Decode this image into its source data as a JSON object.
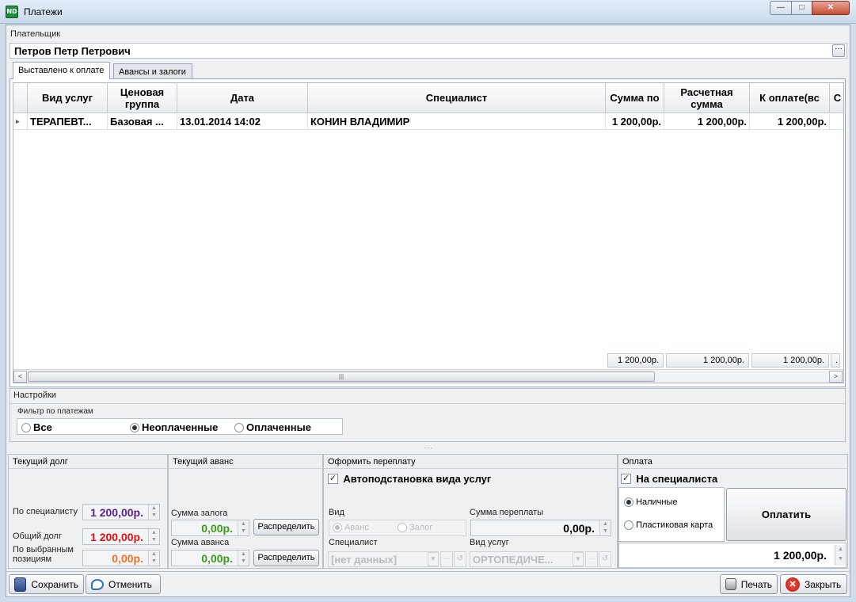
{
  "window": {
    "title": "Платежи",
    "icon_text": "ND",
    "min": "—",
    "max": "□",
    "close": "✕"
  },
  "payer": {
    "label": "Плательщик",
    "value": "Петров Петр Петрович",
    "more": "···"
  },
  "tabs": [
    {
      "label": "Выставлено к оплате"
    },
    {
      "label": "Авансы и залоги"
    }
  ],
  "grid": {
    "columns": [
      "Вид услуг",
      "Ценовая группа",
      "Дата",
      "Специалист",
      "Сумма по",
      "Расчетная сумма",
      "К оплате(вс",
      "С"
    ],
    "rows": [
      {
        "cells": [
          "ТЕРАПЕВТ...",
          "Базовая ...",
          "13.01.2014 14:02",
          "КОНИН ВЛАДИМИР",
          "1 200,00р.",
          "1 200,00р.",
          "1 200,00р.",
          ""
        ]
      }
    ],
    "row_marker": "▸",
    "footer": [
      "1 200,00р.",
      "1 200,00р.",
      "1 200,00р.",
      "."
    ],
    "scroll_grip": "|||",
    "scroll_left": "<",
    "scroll_right": ">"
  },
  "settings": {
    "label": "Настройки",
    "filter_label": "Фильтр по платежам",
    "options": [
      {
        "label": "Все"
      },
      {
        "label": "Неоплаченные"
      },
      {
        "label": "Оплаченные"
      }
    ],
    "selected": "Неоплаченные"
  },
  "splitter_grip": "····",
  "current_debt": {
    "title": "Текущий долг",
    "by_specialist_label": "По специалисту",
    "by_specialist": "1 200,00р.",
    "total_label": "Общий долг",
    "total": "1 200,00р.",
    "selected_label": "По выбранным позициям",
    "selected": "0,00р."
  },
  "current_advance": {
    "title": "Текущий аванс",
    "deposit_label": "Сумма залога",
    "deposit": "0,00р.",
    "advance_label": "Сумма аванса",
    "advance": "0,00р.",
    "distribute": "Распределить"
  },
  "overpay": {
    "title": "Оформить переплату",
    "auto_label": "Автоподстановка вида услуг",
    "kind_label": "Вид",
    "kind_options": [
      "Аванс",
      "Залог"
    ],
    "amount_label": "Сумма переплаты",
    "amount": "0,00р.",
    "specialist_label": "Специалист",
    "specialist": "[нет данных]",
    "service_label": "Вид услуг",
    "service": "ОРТОПЕДИЧЕ..."
  },
  "payment": {
    "title": "Оплата",
    "to_specialist": "На специалиста",
    "methods": [
      "Наличные",
      "Пластиковая карта"
    ],
    "pay_button": "Оплатить",
    "amount": "1 200,00р."
  },
  "toolbar": {
    "save": "Сохранить",
    "cancel": "Отменить",
    "print": "Печать",
    "close": "Закрыть"
  },
  "colors": {
    "debt_specialist": "#5b1f8f",
    "debt_total": "#e01010",
    "debt_selected": "#f07020",
    "advance_values": "#3a9a1a"
  }
}
